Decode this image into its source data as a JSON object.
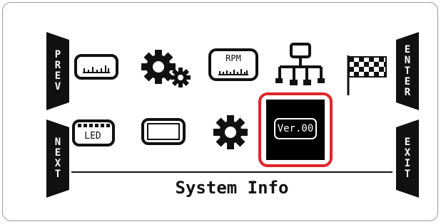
{
  "nav": {
    "prev_label": "PREV",
    "next_label": "NEXT",
    "enter_label": "ENTER",
    "exit_label": "EXIT"
  },
  "menu": {
    "title": "System Info",
    "rpm_icon_text": "RPM",
    "led_icon_text": "LED",
    "version_icon_text": "Ver.00"
  },
  "colors": {
    "selection_border": "#e0262b",
    "tab_background": "#111111",
    "selected_tile": "#000000"
  },
  "icons": [
    "gauge-icon",
    "gears-icon",
    "rpm-gauge-icon",
    "network-icon",
    "checkered-flag-icon",
    "led-icon",
    "display-icon",
    "gear-icon",
    "version-icon"
  ]
}
